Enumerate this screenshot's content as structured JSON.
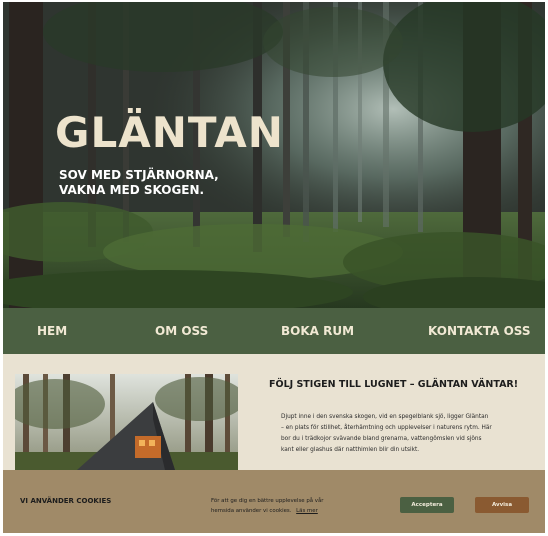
{
  "hero": {
    "title": "GLÄNTAN",
    "tagline": "SOV MED STJÄRNORNA, VAKNA MED SKOGEN."
  },
  "nav": {
    "items": [
      "HEM",
      "OM OSS",
      "BOKA RUM",
      "KONTAKTA OSS"
    ]
  },
  "main": {
    "heading": "FÖLJ STIGEN TILL LUGNET – GLÄNTAN VÄNTAR!",
    "body": "Djupt inne i den svenska skogen, vid en spegelblank sjö, ligger Gläntan – en plats för stillhet, återhämtning och upplevelser i naturens rytm. Här bor du i trädkojor svävande bland grenarna, vattengömslen vid sjöns kant eller glashus där natthimlen blir din utsikt."
  },
  "cookie": {
    "title": "VI ANVÄNDER COOKIES",
    "text": "För att ge dig en bättre upplevelse på vår hemsida använder vi cookies.",
    "link": "Läs mer",
    "accept": "Acceptera",
    "reject": "Avvisa"
  },
  "colors": {
    "nav_bg": "#4b6042",
    "content_bg": "#e9e2d2",
    "cookie_bg": "#a08a68",
    "accept_bg": "#4b6042",
    "reject_bg": "#8a5a31"
  }
}
